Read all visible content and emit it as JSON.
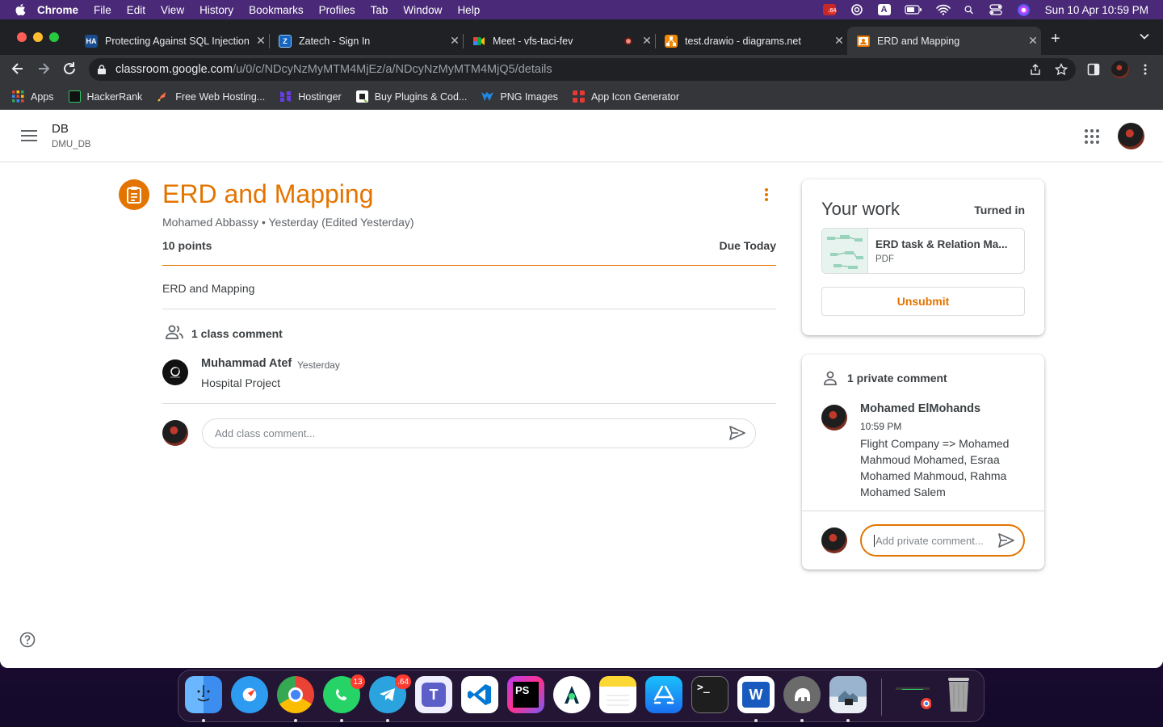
{
  "menubar": {
    "app": "Chrome",
    "items": [
      "File",
      "Edit",
      "View",
      "History",
      "Bookmarks",
      "Profiles",
      "Tab",
      "Window",
      "Help"
    ],
    "clock": "Sun 10 Apr  10:59 PM",
    "status_badge": ".64"
  },
  "tabs": [
    {
      "title": "Protecting Against SQL Injection",
      "favicon": "HA",
      "color": "#1a4d8f"
    },
    {
      "title": "Zatech - Sign In",
      "favicon": "Z",
      "color": "#1565c0"
    },
    {
      "title": "Meet - vfs-taci-fev",
      "favicon": "meet",
      "color": "#00832d"
    },
    {
      "title": "test.drawio - diagrams.net",
      "favicon": "drawio",
      "color": "#f08705"
    },
    {
      "title": "ERD and Mapping",
      "favicon": "classroom",
      "color": "#e37400"
    }
  ],
  "omnibox": {
    "host": "classroom.google.com",
    "path": "/u/0/c/NDcyNzMyMTM4MjEz/a/NDcyNzMyMTM4MjQ5/details"
  },
  "bookmarks": [
    {
      "label": "Apps",
      "color": "#4285f4"
    },
    {
      "label": "HackerRank",
      "color": "#111111"
    },
    {
      "label": "Free Web Hosting...",
      "color": "#ff7043"
    },
    {
      "label": "Hostinger",
      "color": "#673de6"
    },
    {
      "label": "Buy Plugins & Cod...",
      "color": "#ffffff"
    },
    {
      "label": "PNG Images",
      "color": "#1e88e5"
    },
    {
      "label": "App Icon Generator",
      "color": "#e53935"
    }
  ],
  "classroom": {
    "class_name": "DB",
    "class_section": "DMU_DB"
  },
  "assignment": {
    "title": "ERD and Mapping",
    "meta": "Mohamed Abbassy • Yesterday (Edited Yesterday)",
    "points": "10 points",
    "due": "Due Today",
    "description": "ERD and Mapping"
  },
  "class_comments": {
    "title": "1 class comment",
    "items": [
      {
        "author": "Muhammad Atef",
        "time": "Yesterday",
        "text": "Hospital Project"
      }
    ],
    "placeholder": "Add class comment..."
  },
  "your_work": {
    "title": "Your work",
    "status": "Turned in",
    "attachment_name": "ERD task & Relation Ma...",
    "attachment_type": "PDF",
    "unsubmit_label": "Unsubmit"
  },
  "private_comments": {
    "title": "1 private comment",
    "items": [
      {
        "author": "Mohamed ElMohands",
        "time": "10:59 PM",
        "text": "Flight Company => Mohamed Mahmoud Mohamed, Esraa Mohamed Mahmoud, Rahma Mohamed Salem"
      }
    ],
    "placeholder": "Add private comment..."
  },
  "dock": {
    "apps": [
      {
        "name": "Finder",
        "color": "#3b8ef0",
        "badge": ""
      },
      {
        "name": "Safari",
        "color": "#2d9cf0",
        "badge": ""
      },
      {
        "name": "Chrome",
        "color": "#ffffff",
        "badge": ""
      },
      {
        "name": "WhatsApp",
        "color": "#25d366",
        "badge": "13"
      },
      {
        "name": "Telegram",
        "color": "#2aa3df",
        "badge": ".64"
      },
      {
        "name": "Teams",
        "color": "#5b5fc7",
        "badge": ""
      },
      {
        "name": "VS Code",
        "color": "#ffffff",
        "badge": ""
      },
      {
        "name": "PhpStorm",
        "color": "#b43ef0",
        "badge": ""
      },
      {
        "name": "Android Studio",
        "color": "#ffffff",
        "badge": ""
      },
      {
        "name": "Notes",
        "color": "#fdd835",
        "badge": ""
      },
      {
        "name": "App Store",
        "color": "#1a8cf0",
        "badge": ""
      },
      {
        "name": "Terminal",
        "color": "#1e1e1e",
        "badge": ""
      },
      {
        "name": "Word",
        "color": "#185abd",
        "badge": ""
      },
      {
        "name": "Sequel Ace",
        "color": "#6b6b6b",
        "badge": ""
      },
      {
        "name": "Preview",
        "color": "#9ab4cf",
        "badge": ""
      }
    ]
  },
  "accent": "#e37400"
}
